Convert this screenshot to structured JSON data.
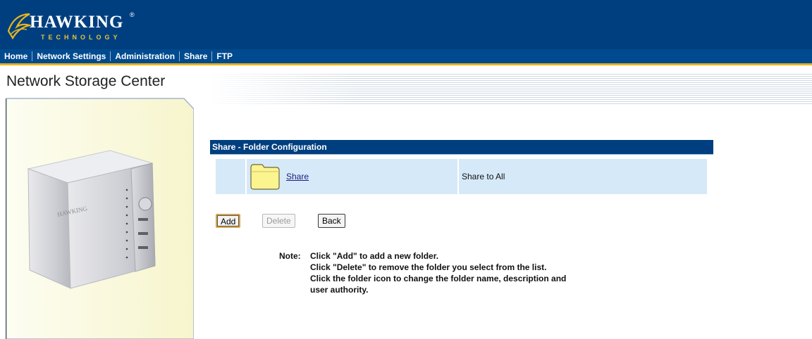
{
  "brand": {
    "name": "HAWKING",
    "tagline": "TECHNOLOGY",
    "registered": "®"
  },
  "nav": {
    "items": [
      "Home",
      "Network Settings",
      "Administration",
      "Share",
      "FTP"
    ]
  },
  "page": {
    "title": "Network Storage Center"
  },
  "section": {
    "title": "Share - Folder Configuration"
  },
  "folders": [
    {
      "name": "Share",
      "description": "Share to All"
    }
  ],
  "buttons": {
    "add": "Add",
    "delete": "Delete",
    "back": "Back"
  },
  "note": {
    "prefix": "Note:",
    "lines": [
      "Click \"Add\" to add a new folder.",
      "Click \"Delete\" to remove the folder you select from the list.",
      "Click the folder icon to change the folder name, description and",
      "user authority."
    ]
  },
  "device_brand": "HAWKING",
  "colors": {
    "header": "#003f7f",
    "accent": "#e6b61f",
    "row": "#d6e9f8",
    "panel": "#fbfbe6"
  }
}
